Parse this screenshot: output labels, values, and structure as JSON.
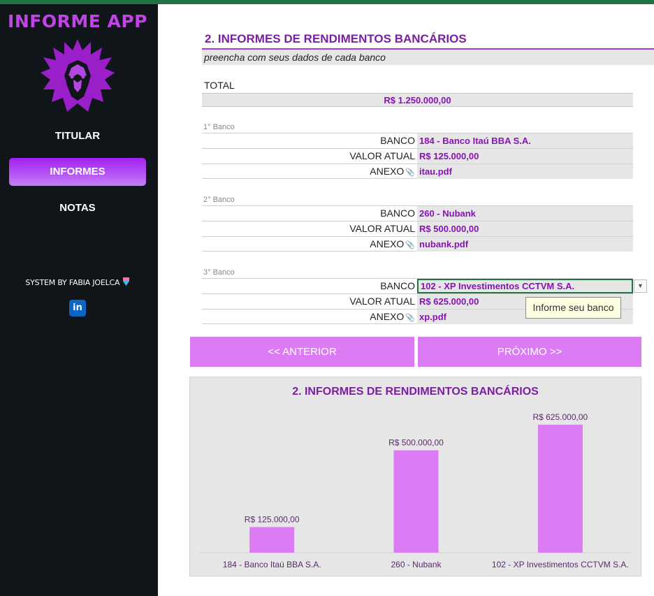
{
  "app": {
    "title": "INFORME APP"
  },
  "nav": {
    "items": [
      {
        "label": "TITULAR"
      },
      {
        "label": "INFORMES"
      },
      {
        "label": "NOTAS"
      }
    ],
    "active": "INFORMES"
  },
  "credit": {
    "text": "SYSTEM BY FABIA JOELCA",
    "linkedin": "in"
  },
  "page": {
    "title": "2. INFORMES DE RENDIMENTOS BANCÁRIOS",
    "subtitle": "preencha com seus dados de cada banco",
    "total_label": "TOTAL",
    "total_value": "R$ 1.250.000,00"
  },
  "field_labels": {
    "banco": "BANCO",
    "valor": "VALOR ATUAL",
    "anexo": "ANEXO"
  },
  "banks": [
    {
      "header": "1° Banco",
      "banco": "184 - Banco Itaú BBA S.A.",
      "valor": "R$ 125.000,00",
      "anexo": "itau.pdf"
    },
    {
      "header": "2° Banco",
      "banco": "260 - Nubank",
      "valor": "R$ 500.000,00",
      "anexo": "nubank.pdf"
    },
    {
      "header": "3° Banco",
      "banco": "102 - XP Investimentos CCTVM S.A.",
      "valor": "R$ 625.000,00",
      "anexo": "xp.pdf"
    }
  ],
  "tooltip": {
    "text": "Informe seu banco"
  },
  "buttons": {
    "prev": "<< ANTERIOR",
    "next": "PRÓXIMO >>"
  },
  "colors": {
    "accent": "#8a10b8",
    "button": "#dc7cf5",
    "sidebar": "#0f1519",
    "bar": "#dc7cf5"
  },
  "chart_data": {
    "type": "bar",
    "title": "2. INFORMES DE RENDIMENTOS BANCÁRIOS",
    "categories": [
      "184 - Banco Itaú BBA S.A.",
      "260 - Nubank",
      "102 - XP Investimentos CCTVM S.A."
    ],
    "values": [
      125000,
      500000,
      625000
    ],
    "data_labels": [
      "R$ 125.000,00",
      "R$ 500.000,00",
      "R$ 625.000,00"
    ],
    "ylim": [
      0,
      720000
    ],
    "grid": false
  }
}
